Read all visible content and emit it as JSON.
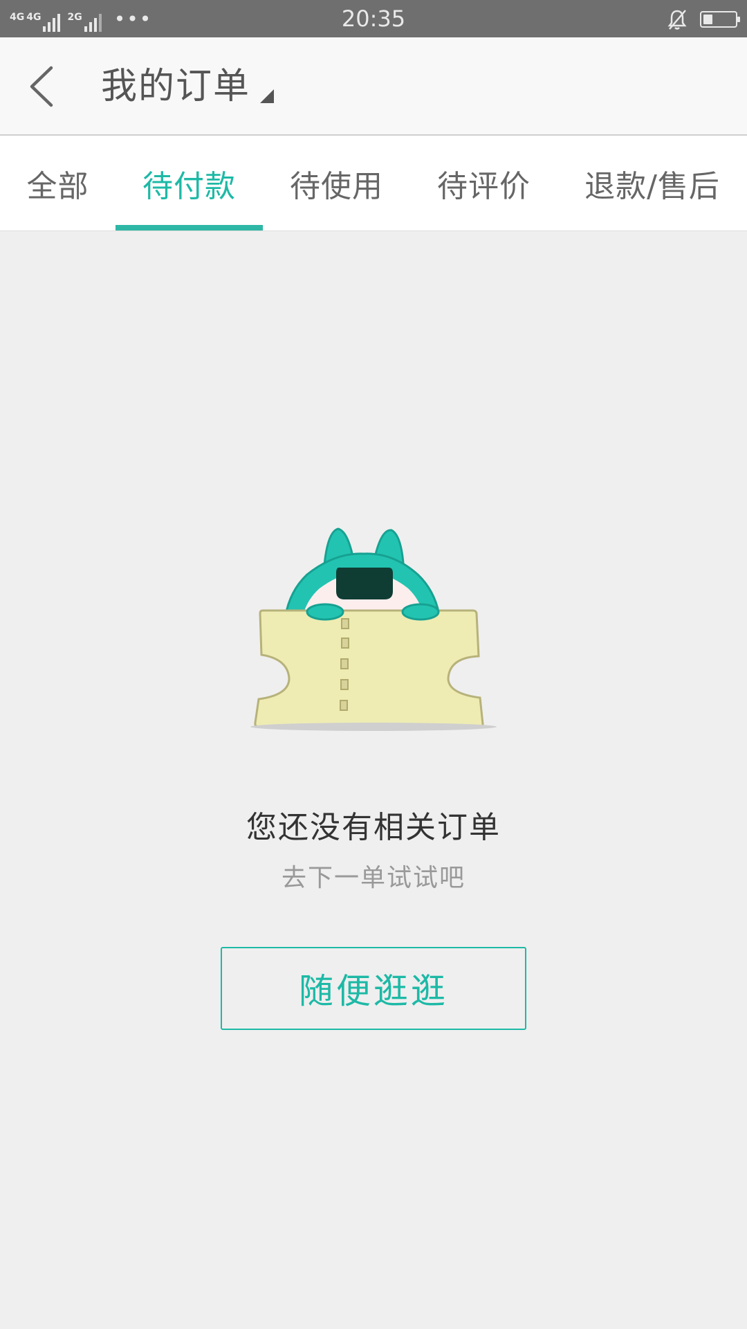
{
  "status_bar": {
    "network_1": "4G",
    "network_2": "4G",
    "network_3": "2G",
    "time": "20:35",
    "battery_level": 0.3,
    "icons": [
      "signal-icon",
      "more-dots-icon",
      "mute-bell-icon",
      "battery-icon"
    ]
  },
  "header": {
    "title": "我的订单",
    "back_icon": "back-arrow-icon",
    "dropdown_icon": "caret-icon"
  },
  "tabs": [
    {
      "label": "全部",
      "active": false
    },
    {
      "label": "待付款",
      "active": true
    },
    {
      "label": "待使用",
      "active": false
    },
    {
      "label": "待评价",
      "active": false
    },
    {
      "label": "退款/售后",
      "active": false
    }
  ],
  "empty_state": {
    "illustration": "ticket-mascot-illustration",
    "title": "您还没有相关订单",
    "subtitle": "去下一单试试吧",
    "button_label": "随便逛逛"
  },
  "colors": {
    "accent": "#1db9a6",
    "status_bar": "#6f6f6f",
    "background": "#efefef"
  }
}
